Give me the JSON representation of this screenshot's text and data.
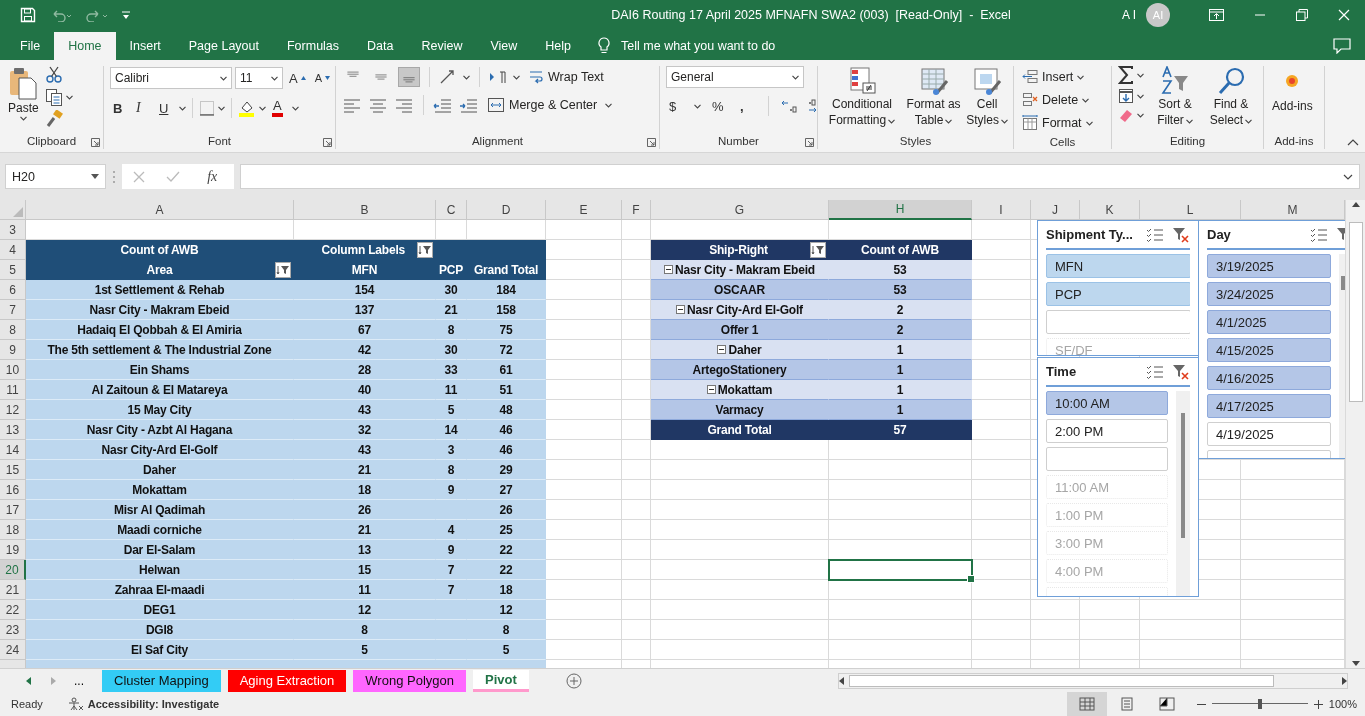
{
  "window": {
    "title": "DAI6 Routing 17 April 2025 MFNAFN SWA2 (003)  [Read-Only]  -  Excel",
    "user_name": "A I",
    "user_initials": "AI"
  },
  "ribbon_tabs": [
    {
      "label": "File",
      "selected": false
    },
    {
      "label": "Home",
      "selected": true
    },
    {
      "label": "Insert",
      "selected": false
    },
    {
      "label": "Page Layout",
      "selected": false
    },
    {
      "label": "Formulas",
      "selected": false
    },
    {
      "label": "Data",
      "selected": false
    },
    {
      "label": "Review",
      "selected": false
    },
    {
      "label": "View",
      "selected": false
    },
    {
      "label": "Help",
      "selected": false
    }
  ],
  "tell_me": "Tell me what you want to do",
  "ribbon": {
    "clipboard": {
      "title": "Clipboard",
      "paste": "Paste"
    },
    "font": {
      "title": "Font",
      "font_name": "Calibri",
      "font_size": "11",
      "grow": "A",
      "shrink": "A",
      "bold": "B",
      "italic": "I",
      "underline": "U",
      "font_color": "A"
    },
    "alignment": {
      "title": "Alignment",
      "vertical_align": [
        {
          "selected": false
        },
        {
          "selected": false
        },
        {
          "selected": true
        }
      ],
      "wrap_text": "Wrap Text",
      "merge_center": "Merge & Center"
    },
    "number": {
      "title": "Number",
      "format": "General",
      "currency": "$",
      "percent": "%",
      "comma": ","
    },
    "styles": {
      "title": "Styles",
      "buttons": [
        "Conditional Formatting",
        "Format as Table",
        "Cell Styles"
      ]
    },
    "cells": {
      "title": "Cells",
      "buttons": [
        "Insert",
        "Delete",
        "Format"
      ]
    },
    "editing": {
      "title": "Editing",
      "buttons": [
        "Sort & Filter",
        "Find & Select"
      ]
    },
    "addins": {
      "title": "Add-ins",
      "buttons": [
        "Add-ins"
      ]
    }
  },
  "formula_bar": {
    "name_box": "H20",
    "fx": "fx"
  },
  "sheet": {
    "columns": [
      {
        "label": "A",
        "selected": false
      },
      {
        "label": "B",
        "selected": false
      },
      {
        "label": "C",
        "selected": false
      },
      {
        "label": "D",
        "selected": false
      },
      {
        "label": "E",
        "selected": false
      },
      {
        "label": "F",
        "selected": false
      },
      {
        "label": "G",
        "selected": false
      },
      {
        "label": "H",
        "selected": true
      },
      {
        "label": "I",
        "selected": false
      },
      {
        "label": "J",
        "selected": false
      },
      {
        "label": "K",
        "selected": false
      },
      {
        "label": "L",
        "selected": false
      },
      {
        "label": "M",
        "selected": false
      }
    ],
    "rows": [
      {
        "label": "3",
        "selected": false
      },
      {
        "label": "4",
        "selected": false
      },
      {
        "label": "5",
        "selected": false
      },
      {
        "label": "6",
        "selected": false
      },
      {
        "label": "7",
        "selected": false
      },
      {
        "label": "8",
        "selected": false
      },
      {
        "label": "9",
        "selected": false
      },
      {
        "label": "10",
        "selected": false
      },
      {
        "label": "11",
        "selected": false
      },
      {
        "label": "12",
        "selected": false
      },
      {
        "label": "13",
        "selected": false
      },
      {
        "label": "14",
        "selected": false
      },
      {
        "label": "15",
        "selected": false
      },
      {
        "label": "16",
        "selected": false
      },
      {
        "label": "17",
        "selected": false
      },
      {
        "label": "18",
        "selected": false
      },
      {
        "label": "19",
        "selected": false
      },
      {
        "label": "20",
        "selected": true
      },
      {
        "label": "21",
        "selected": false
      },
      {
        "label": "22",
        "selected": false
      },
      {
        "label": "23",
        "selected": false
      },
      {
        "label": "24",
        "selected": false
      }
    ]
  },
  "pivot_area": {
    "value_field": "Count of AWB",
    "column_labels": "Column Labels",
    "row_field": "Area",
    "columns": [
      "MFN",
      "PCP",
      "Grand Total"
    ],
    "rows": [
      {
        "area": "1st Settlement & Rehab",
        "values": [
          "154",
          "30",
          "184"
        ]
      },
      {
        "area": "Nasr City - Makram Ebeid",
        "values": [
          "137",
          "21",
          "158"
        ]
      },
      {
        "area": "Hadaiq El Qobbah & El Amiria",
        "values": [
          "67",
          "8",
          "75"
        ]
      },
      {
        "area": "The 5th settlement & The Industrial Zone",
        "values": [
          "42",
          "30",
          "72"
        ]
      },
      {
        "area": "Ein Shams",
        "values": [
          "28",
          "33",
          "61"
        ]
      },
      {
        "area": "Al Zaitoun & El Matareya",
        "values": [
          "40",
          "11",
          "51"
        ]
      },
      {
        "area": "15 May City",
        "values": [
          "43",
          "5",
          "48"
        ]
      },
      {
        "area": "Nasr City - Azbt Al Hagana",
        "values": [
          "32",
          "14",
          "46"
        ]
      },
      {
        "area": "Nasr City-Ard El-Golf",
        "values": [
          "43",
          "3",
          "46"
        ]
      },
      {
        "area": "Daher",
        "values": [
          "21",
          "8",
          "29"
        ]
      },
      {
        "area": "Mokattam",
        "values": [
          "18",
          "9",
          "27"
        ]
      },
      {
        "area": "Misr Al Qadimah",
        "values": {
          "mfn": "26",
          "total": "26"
        }
      },
      {
        "area": "Maadi corniche",
        "values": [
          "21",
          "4",
          "25"
        ]
      },
      {
        "area": "Dar El-Salam",
        "values": [
          "13",
          "9",
          "22"
        ]
      },
      {
        "area": "Helwan",
        "values": [
          "15",
          "7",
          "22"
        ]
      },
      {
        "area": "Zahraa El-maadi",
        "values": [
          "11",
          "7",
          "18"
        ]
      },
      {
        "area": "DEG1",
        "values": {
          "mfn": "12",
          "total": "12"
        }
      },
      {
        "area": "DGI8",
        "values": {
          "mfn": "8",
          "total": "8"
        }
      },
      {
        "area": "El Saf City",
        "values": {
          "mfn": "5",
          "total": "5"
        }
      }
    ]
  },
  "pivot_ship": {
    "row_field": "Ship-Right",
    "value_field": "Count of AWB",
    "rows": [
      {
        "label": "Nasr City - Makram Ebeid",
        "count": "53",
        "expanded": true,
        "children": [
          {
            "label": "OSCAAR",
            "count": "53"
          }
        ]
      },
      {
        "label": "Nasr City-Ard El-Golf",
        "count": "2",
        "expanded": true,
        "children": [
          {
            "label": "Offer 1",
            "count": "2"
          }
        ]
      },
      {
        "label": "Daher",
        "count": "1",
        "expanded": true,
        "children": [
          {
            "label": "ArtegoStationery",
            "count": "1"
          }
        ]
      },
      {
        "label": "Mokattam",
        "count": "1",
        "expanded": true,
        "children": [
          {
            "label": "Varmacy",
            "count": "1"
          }
        ]
      }
    ],
    "total_label": "Grand Total",
    "total": "57"
  },
  "slicers": [
    {
      "title": "Shipment Ty...",
      "items": [
        {
          "label": "MFN",
          "selected": true,
          "disabled": false
        },
        {
          "label": "PCP",
          "selected": true,
          "disabled": false
        },
        {
          "selected": false,
          "disabled": false
        },
        {
          "label": "SF/DF",
          "selected": false,
          "disabled": true
        }
      ]
    },
    {
      "title": "Time",
      "items": [
        {
          "label": "10:00 AM",
          "selected": true,
          "disabled": false
        },
        {
          "label": "2:00 PM",
          "selected": false,
          "disabled": false
        },
        {
          "selected": false,
          "disabled": false
        },
        {
          "label": "11:00 AM",
          "selected": false,
          "disabled": true
        },
        {
          "label": "1:00 PM",
          "selected": false,
          "disabled": true
        },
        {
          "label": "3:00 PM",
          "selected": false,
          "disabled": true
        },
        {
          "label": "4:00 PM",
          "selected": false,
          "disabled": true
        },
        {
          "selected": false,
          "disabled": true
        }
      ]
    },
    {
      "title": "Day",
      "items": [
        {
          "label": "3/19/2025",
          "selected": true,
          "disabled": false
        },
        {
          "label": "3/24/2025",
          "selected": true,
          "disabled": false
        },
        {
          "label": "4/1/2025",
          "selected": true,
          "disabled": false
        },
        {
          "label": "4/15/2025",
          "selected": true,
          "disabled": false
        },
        {
          "label": "4/16/2025",
          "selected": true,
          "disabled": false
        },
        {
          "label": "4/17/2025",
          "selected": true,
          "disabled": false
        },
        {
          "label": "4/19/2025",
          "selected": false,
          "disabled": false
        },
        {
          "selected": false,
          "disabled": false
        }
      ]
    }
  ],
  "sheet_tabs": {
    "more": "...",
    "tabs": [
      {
        "label": "Cluster Mapping",
        "color": "#33ccf5",
        "selected": false
      },
      {
        "label": "Aging Extraction",
        "color": "#ff0000",
        "selected": false
      },
      {
        "label": "Wrong Polygon",
        "color": "#ff66ff",
        "selected": false
      },
      {
        "label": "Pivot",
        "color": "#ff99cc",
        "selected": true
      }
    ]
  },
  "status_bar": {
    "ready": "Ready",
    "accessibility": "Accessibility: Investigate",
    "views": [
      {
        "selected": true
      },
      {
        "selected": false
      },
      {
        "selected": false
      }
    ],
    "zoom_slider": {
      "level": 0.5
    },
    "zoom": "100%"
  }
}
